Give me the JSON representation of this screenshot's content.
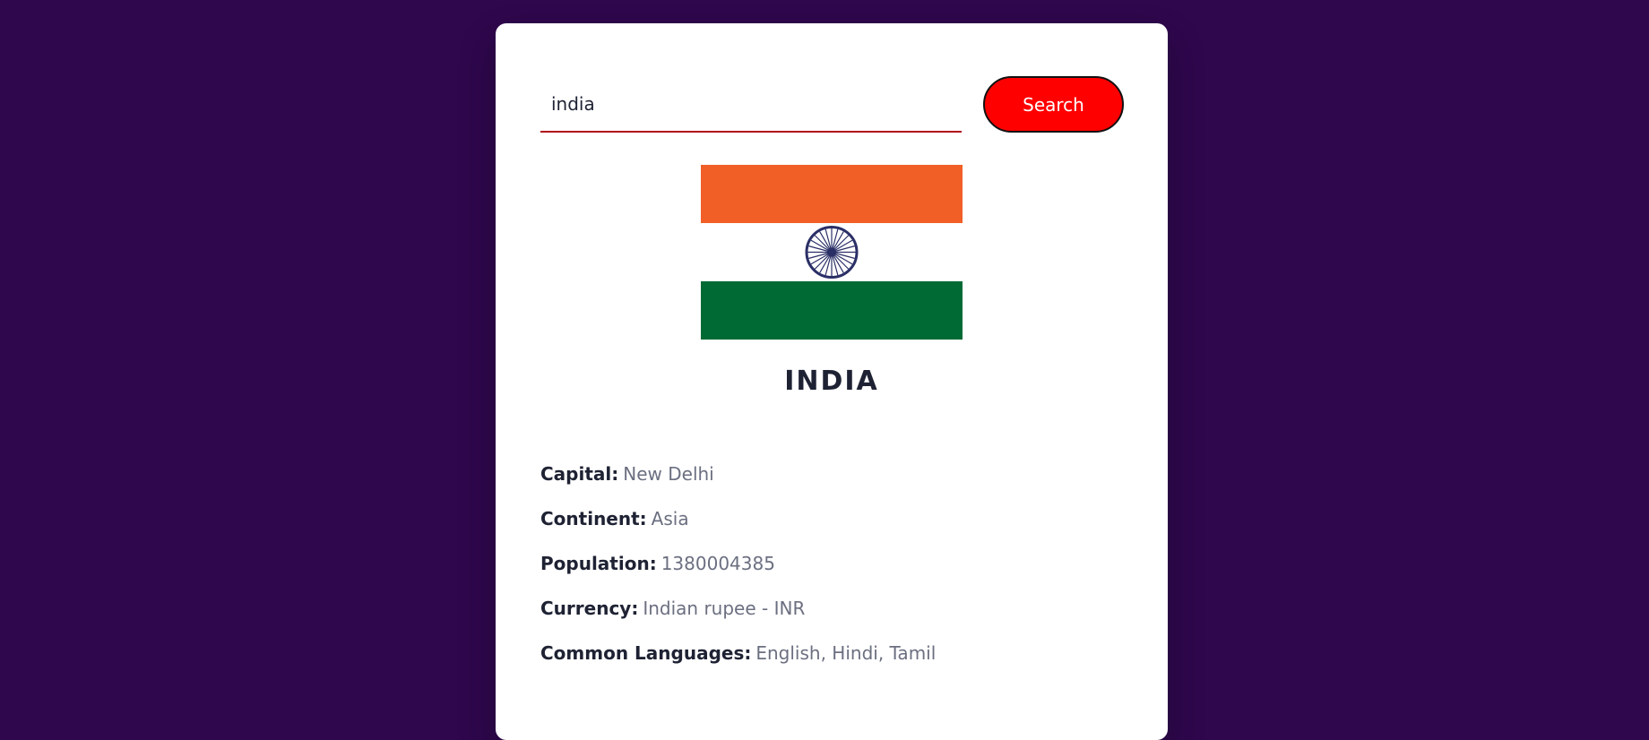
{
  "search": {
    "value": "india",
    "button_label": "Search"
  },
  "flag": {
    "stripe_top_color": "#f15f26",
    "stripe_middle_color": "#ffffff",
    "stripe_bottom_color": "#006a35",
    "chakra_color": "#2a2f66"
  },
  "country": {
    "name": "INDIA"
  },
  "details": [
    {
      "label": "Capital:",
      "value": "New Delhi"
    },
    {
      "label": "Continent:",
      "value": "Asia"
    },
    {
      "label": "Population:",
      "value": "1380004385"
    },
    {
      "label": "Currency:",
      "value": "Indian rupee - INR"
    },
    {
      "label": "Common Languages:",
      "value": "English, Hindi, Tamil"
    }
  ]
}
